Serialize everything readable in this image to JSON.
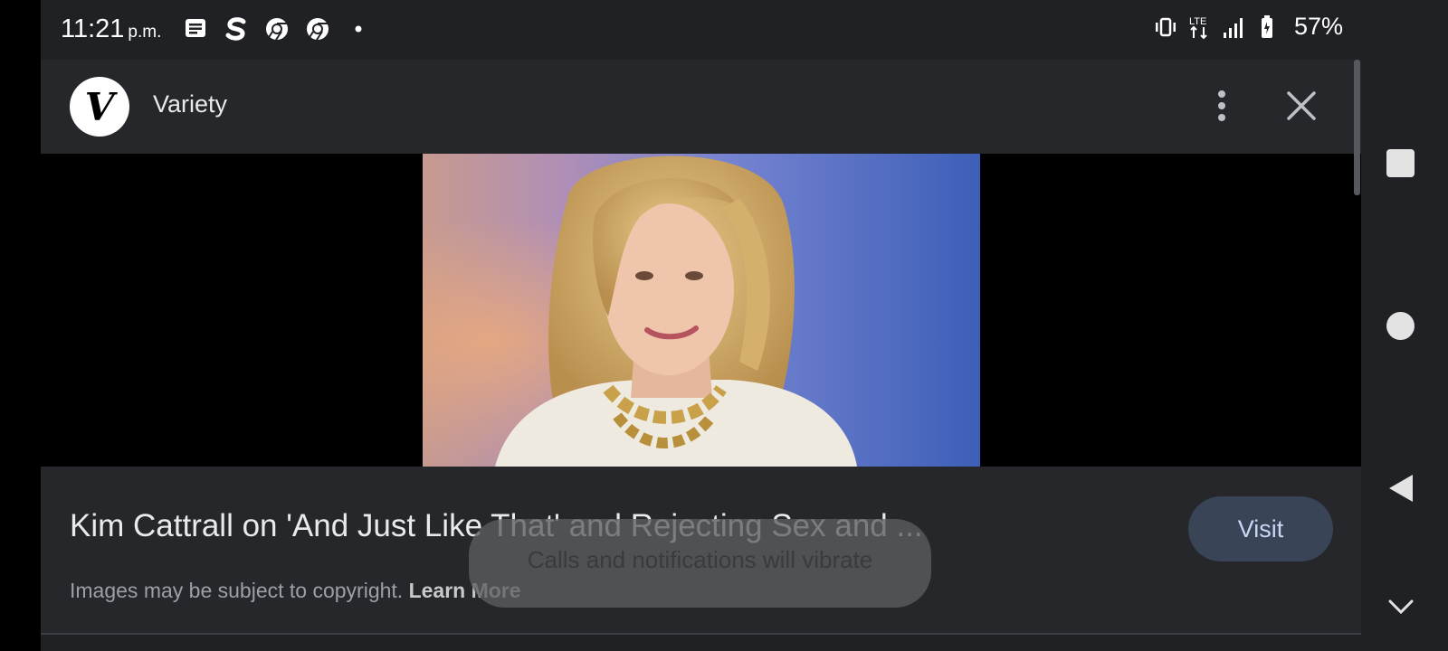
{
  "status_bar": {
    "time": "11:21",
    "ampm": "p.m.",
    "battery": "57%",
    "network": "LTE",
    "left_icons": [
      "messages-icon",
      "s-app-icon",
      "chrome-icon",
      "chrome-icon",
      "dot-icon"
    ],
    "right_icons": [
      "vibrate-icon",
      "lte-icon",
      "signal-icon",
      "battery-icon"
    ]
  },
  "header": {
    "logo_letter": "V",
    "site_name": "Variety",
    "more_icon": "more-vert-icon",
    "close_icon": "close-icon"
  },
  "image": {
    "description_icon": "photo-image"
  },
  "info": {
    "title": "Kim Cattrall on 'And Just Like That' and Rejecting Sex and ...",
    "visit_label": "Visit",
    "copyright_text": "Images may be subject to copyright.",
    "learn_more": "Learn More"
  },
  "toast": {
    "text": "Calls and notifications will vibrate"
  },
  "nav": {
    "icons": [
      "recents-icon",
      "home-icon",
      "back-icon",
      "chevron-down-icon"
    ]
  },
  "colors": {
    "background": "#202124",
    "panel": "#26272b",
    "visit_button": "#394457",
    "text_primary": "#e8eaed",
    "text_secondary": "#9aa0a6"
  }
}
